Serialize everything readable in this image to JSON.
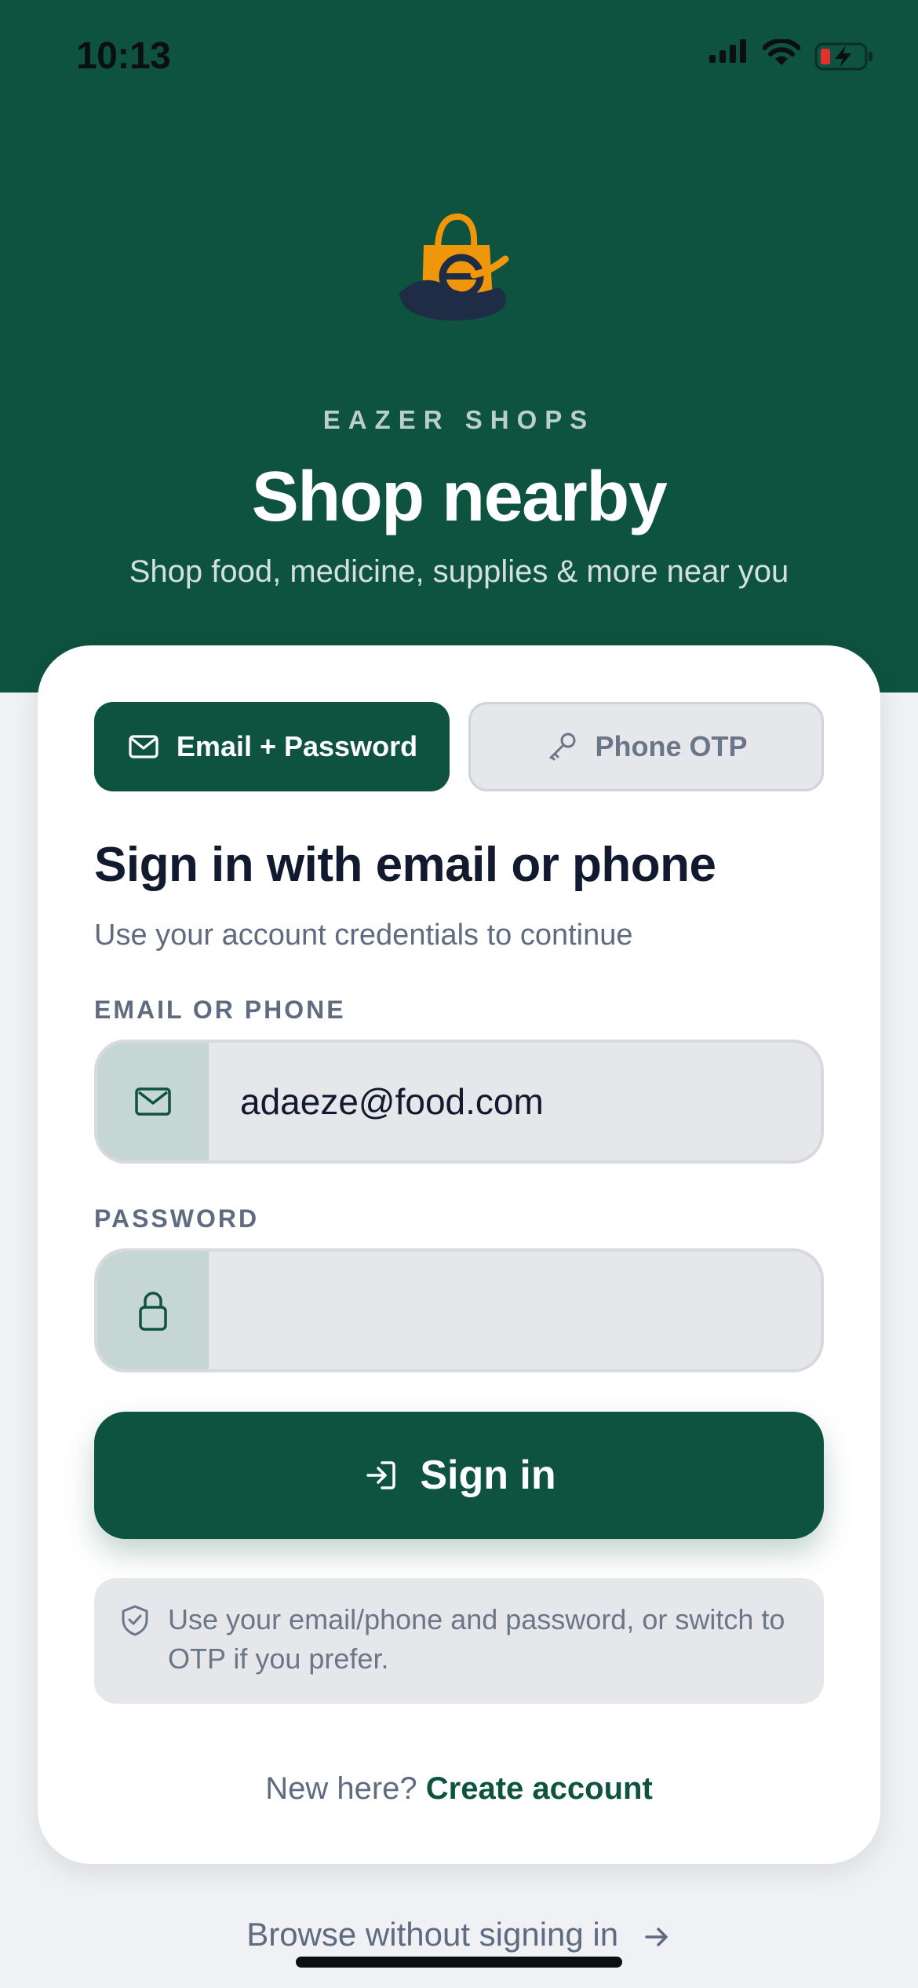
{
  "status_bar": {
    "time": "10:13"
  },
  "header": {
    "brand": "EAZER SHOPS",
    "headline": "Shop nearby",
    "tagline": "Shop food, medicine, supplies & more near you"
  },
  "tabs": [
    {
      "label": "Email + Password",
      "icon": "envelope-icon",
      "active": true
    },
    {
      "label": "Phone OTP",
      "icon": "key-icon",
      "active": false
    }
  ],
  "form": {
    "title": "Sign in with email or phone",
    "subtitle": "Use your account credentials to continue",
    "email_label": "EMAIL OR PHONE",
    "email_value": "adaeze@food.com",
    "password_label": "PASSWORD",
    "password_value": ""
  },
  "sign_in_button": {
    "label": "Sign in",
    "icon": "sign-in-icon"
  },
  "note": {
    "text": "Use your email/phone and password, or switch to OTP if you prefer.",
    "icon": "shield-check-icon"
  },
  "footer": {
    "new_here": "New here?",
    "create_account": "Create account",
    "browse": "Browse without signing in"
  },
  "colors": {
    "primary": "#0e5240",
    "accent": "#f0960a",
    "muted_text": "#5f6b80",
    "field_bg": "#e6e7eb"
  }
}
